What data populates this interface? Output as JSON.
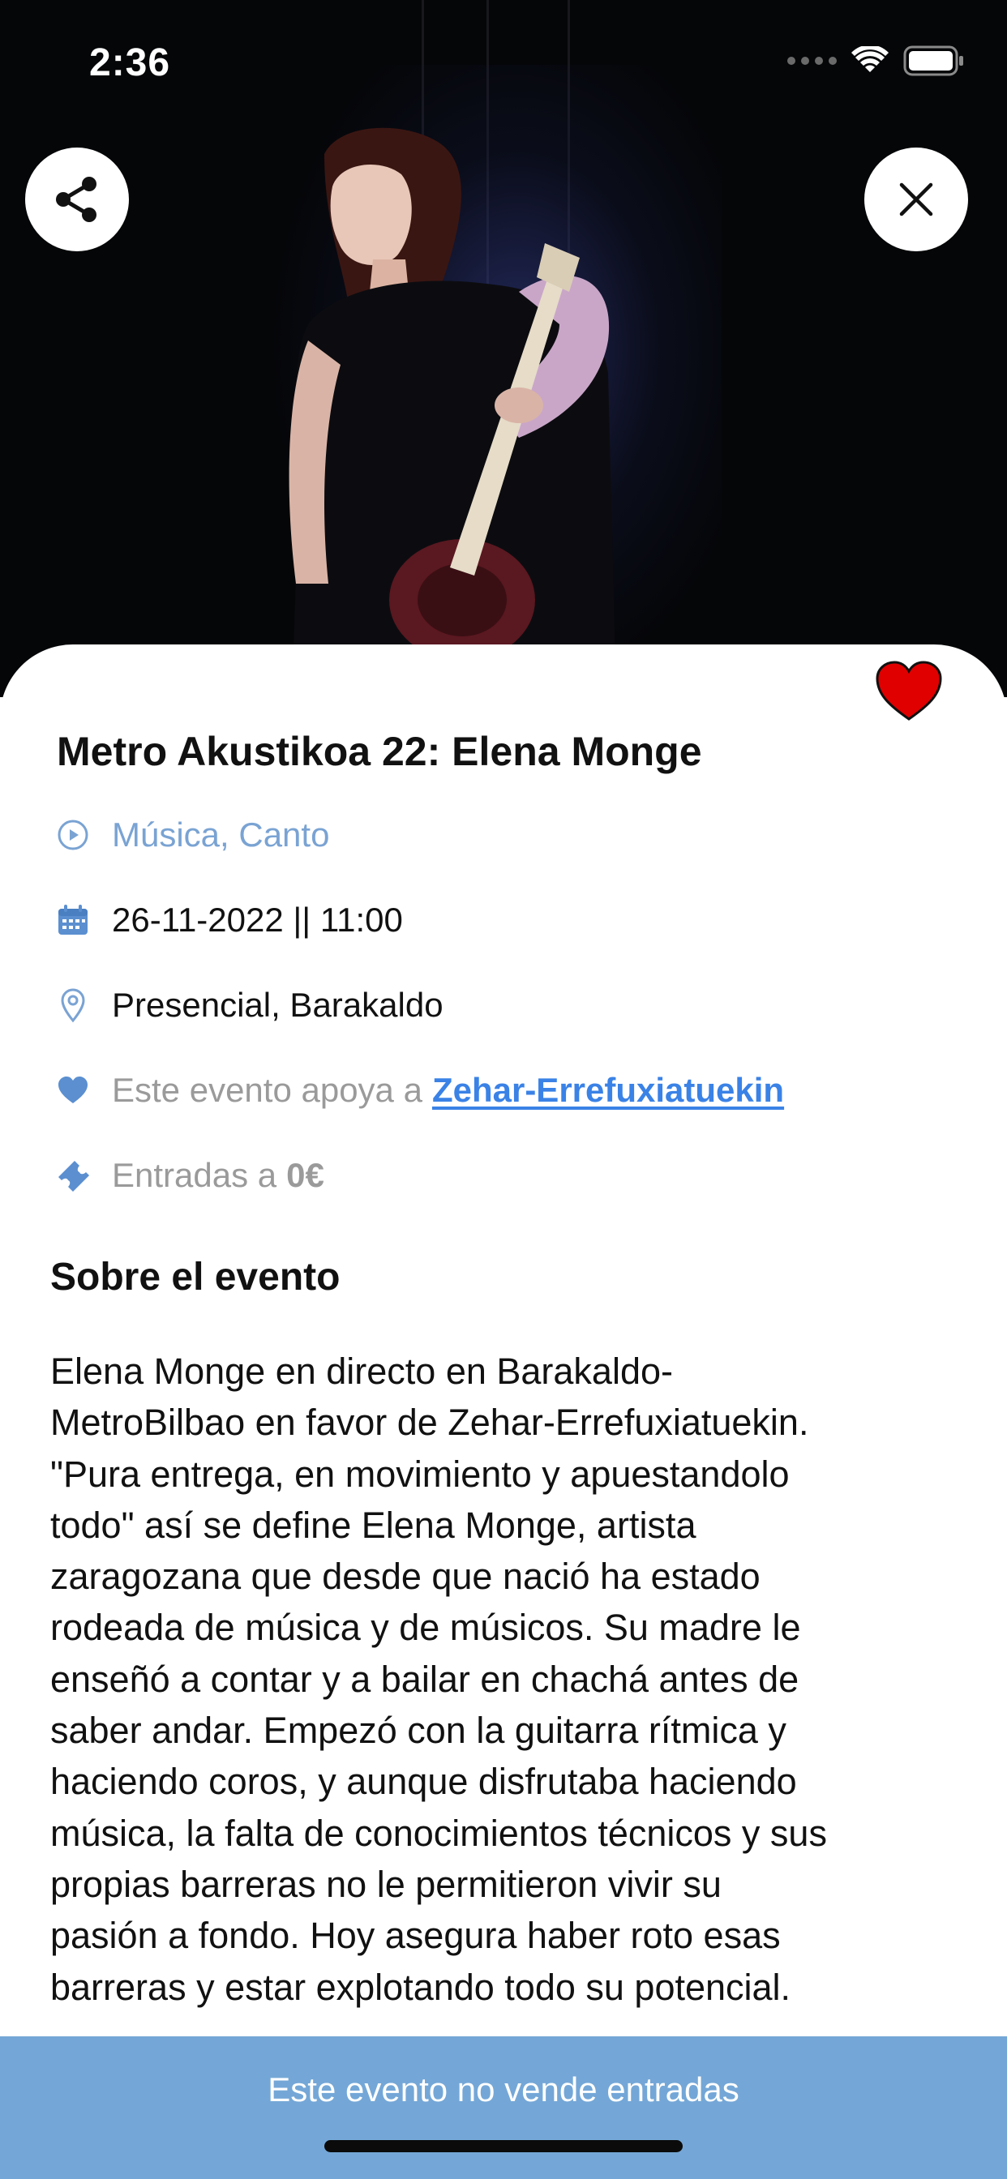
{
  "status_bar": {
    "time": "2:36"
  },
  "event": {
    "title": "Metro Akustikoa 22: Elena Monge",
    "category": "Música, Canto",
    "datetime": "26-11-2022 || 11:00",
    "location": "Presencial, Barakaldo",
    "support_prefix": "Este evento apoya a",
    "support_link": "Zehar-Errefuxiatuekin",
    "tickets_prefix": "Entradas a",
    "tickets_price": "0€"
  },
  "about": {
    "heading": "Sobre el evento",
    "text": "Elena Monge en directo en Barakaldo-\nMetroBilbao en favor de Zehar-Errefuxiatuekin.\n\"Pura entrega, en movimiento y apuestandolo\ntodo\" así se define Elena Monge, artista\nzaragozana que desde que nació ha estado\nrodeada de música y de músicos. Su madre le\nenseñó a contar y a bailar en chachá antes de\nsaber andar. Empezó con la guitarra rítmica y\nhaciendo coros, y aunque disfrutaba haciendo\nmúsica, la falta de conocimientos técnicos y sus\npropias barreras no le permitieron vivir su\npasión a fondo. Hoy asegura haber roto esas\nbarreras y estar explotando todo su potencial."
  },
  "bottom_bar": {
    "label": "Este evento no vende entradas"
  },
  "icons": {
    "share": "share-icon",
    "close": "close-icon",
    "favorite": "heart-icon",
    "category": "play-circle-icon",
    "date": "calendar-icon",
    "location": "map-pin-icon",
    "support": "heart-icon",
    "tickets": "ticket-icon"
  },
  "colors": {
    "accent_blue": "#74a7d7",
    "category_text": "#7aa3d3",
    "link": "#3a82e6",
    "muted_text": "#9a9a9a",
    "favorite_red": "#e00000"
  }
}
